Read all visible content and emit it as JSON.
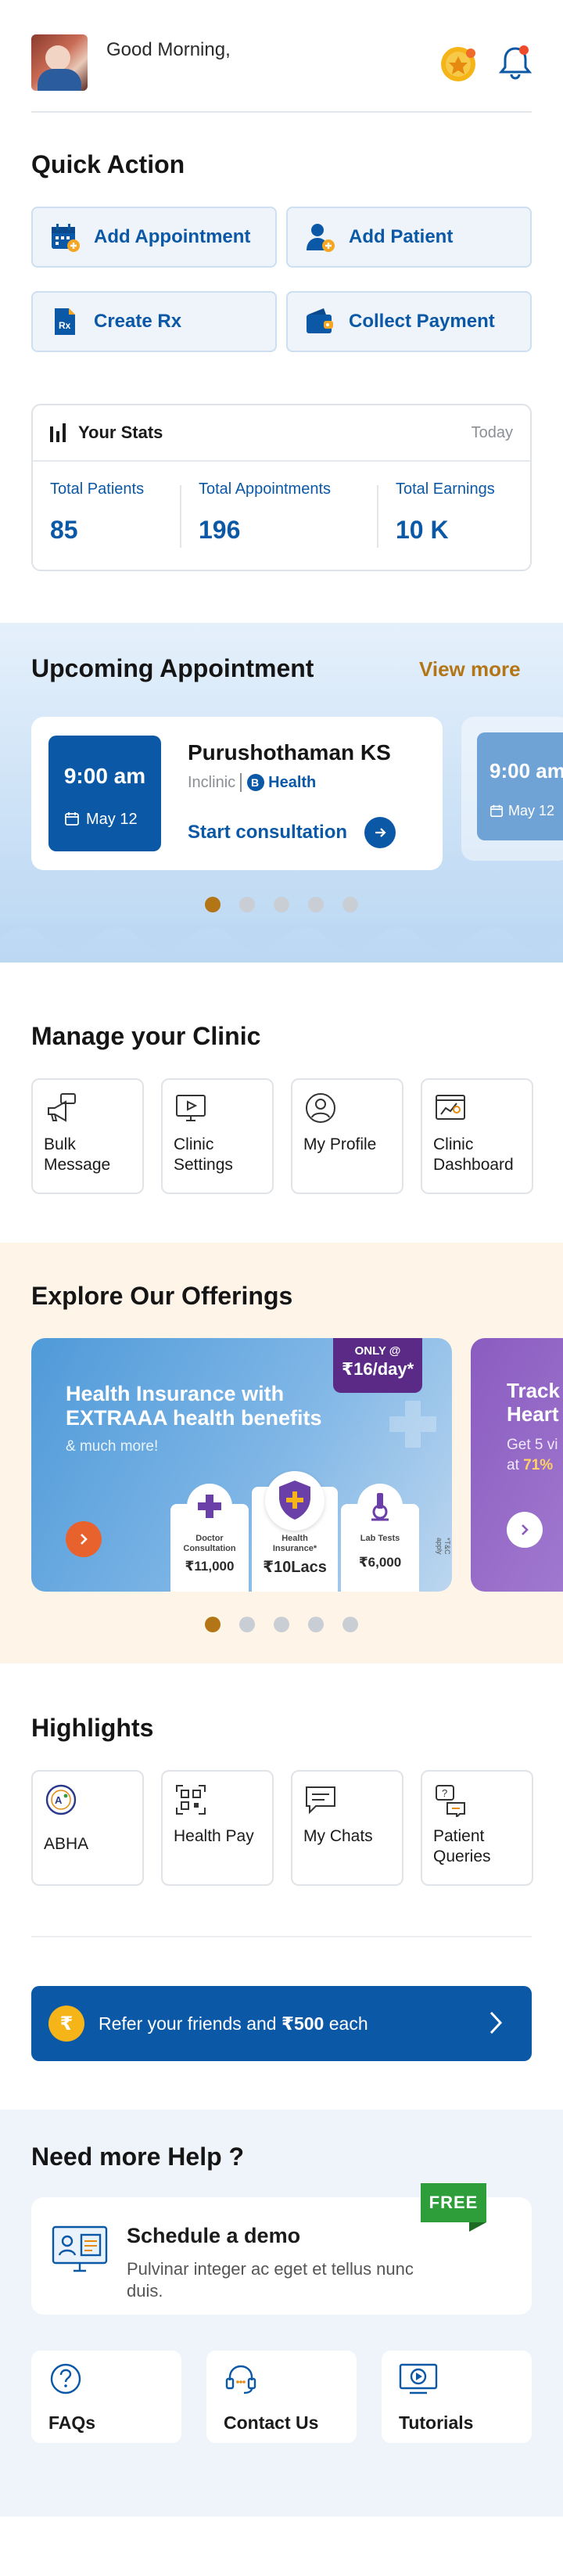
{
  "header": {
    "greeting": "Good Morning,",
    "avatar_icon": "user-photo",
    "coin_icon": "coin-icon",
    "notification_icon": "bell-icon"
  },
  "quick_action": {
    "title": "Quick Action",
    "buttons": [
      {
        "label": "Add Appointment",
        "icon": "calendar-add-icon"
      },
      {
        "label": "Add Patient",
        "icon": "person-add-icon"
      },
      {
        "label": "Create Rx",
        "icon": "prescription-icon"
      },
      {
        "label": "Collect Payment",
        "icon": "wallet-icon"
      }
    ]
  },
  "stats": {
    "title": "Your Stats",
    "period": "Today",
    "items": [
      {
        "label": "Total Patients",
        "value": "85"
      },
      {
        "label": "Total Appointments",
        "value": "196"
      },
      {
        "label": "Total Earnings",
        "value": "10 K"
      }
    ]
  },
  "upcoming": {
    "title": "Upcoming Appointment",
    "view_more": "View more",
    "appointments": [
      {
        "time": "9:00 am",
        "date": "May 12",
        "patient": "Purushothaman KS",
        "clinic": "Inclinic",
        "brand": "Health",
        "action": "Start consultation"
      },
      {
        "time": "9:00 am",
        "date": "May 12"
      }
    ],
    "carousel_pages": 5,
    "active_page": 0
  },
  "manage": {
    "title": "Manage your Clinic",
    "tiles": [
      {
        "label": "Bulk Message",
        "icon": "megaphone-icon"
      },
      {
        "label": "Clinic Settings",
        "icon": "monitor-settings-icon"
      },
      {
        "label": "My Profile",
        "icon": "profile-icon"
      },
      {
        "label": "Clinic Dashboard",
        "icon": "dashboard-icon"
      }
    ]
  },
  "offerings": {
    "title": "Explore Our Offerings",
    "cards": [
      {
        "title_bold": "Health Insurance",
        "title_rest": " with EXTRAAA health benefits",
        "subtitle": "& much more!",
        "badge_top": "ONLY @",
        "badge_price": "₹16/day*",
        "tnc": "*T&C apply",
        "features": [
          {
            "name": "Doctor Consultation",
            "price": "₹11,000"
          },
          {
            "name": "Health Insurance*",
            "price": "₹10Lacs"
          },
          {
            "name": "Lab Tests",
            "price": "₹6,000"
          }
        ]
      },
      {
        "title": "Track Heart",
        "subtitle_1": "Get 5 vi",
        "subtitle_2_prefix": "at ",
        "subtitle_2_bold": "71%"
      }
    ],
    "carousel_pages": 5,
    "active_page": 0
  },
  "highlights": {
    "title": "Highlights",
    "tiles": [
      {
        "label": "ABHA",
        "icon": "abha-logo-icon"
      },
      {
        "label": "Health Pay",
        "icon": "qr-code-icon"
      },
      {
        "label": "My Chats",
        "icon": "chat-icon"
      },
      {
        "label": "Patient Queries",
        "icon": "question-chat-icon"
      }
    ]
  },
  "refer": {
    "text_prefix": "Refer your friends and ",
    "amount": "₹500",
    "text_suffix": " each",
    "coin_symbol": "₹"
  },
  "help": {
    "title": "Need more Help ?",
    "demo_title": "Schedule a demo",
    "demo_subtitle": "Pulvinar integer ac eget et tellus nunc duis.",
    "free_tag": "FREE",
    "cards": [
      {
        "label": "FAQs",
        "icon": "question-circle-icon"
      },
      {
        "label": "Contact Us",
        "icon": "headset-chat-icon"
      },
      {
        "label": "Tutorials",
        "icon": "video-play-icon"
      }
    ]
  },
  "colors": {
    "primary": "#0b58a6",
    "accent": "#b37617",
    "free_green": "#2e9e3a"
  }
}
